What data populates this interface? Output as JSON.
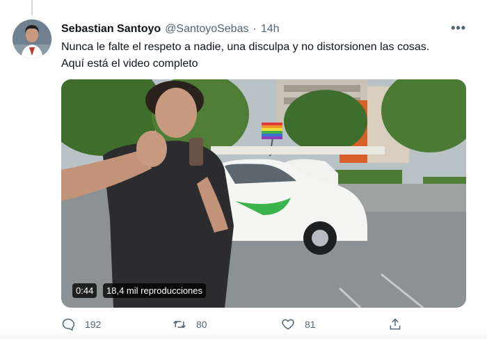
{
  "tweet": {
    "display_name": "Sebastian Santoyo",
    "handle": "@SantoyoSebas",
    "separator": "·",
    "time": "14h",
    "more_label": "•••",
    "text": "Nunca le falte el respeto a nadie, una disculpa y no distorsionen las cosas. Aquí está el video completo",
    "avatar_icon": "profile-photo"
  },
  "video": {
    "duration": "0:44",
    "views": "18,4 mil reproducciones"
  },
  "actions": {
    "reply_count": "192",
    "retweet_count": "80",
    "like_count": "81",
    "reply_icon": "comment-icon",
    "retweet_icon": "retweet-icon",
    "like_icon": "heart-icon",
    "share_icon": "share-icon"
  },
  "colors": {
    "text_primary": "#0f1419",
    "text_secondary": "#536471",
    "thread_line": "#cfd9de"
  }
}
